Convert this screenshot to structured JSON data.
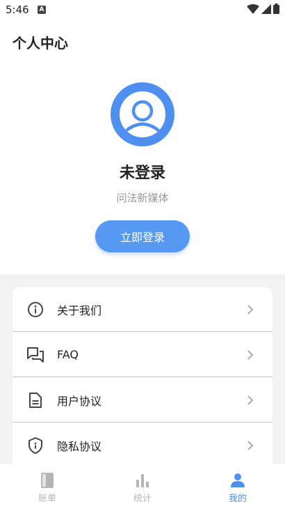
{
  "status_bar": {
    "time": "5:46",
    "notification_icon": "a-icon",
    "wifi_icon": "wifi-icon",
    "signal_icon": "signal-icon",
    "battery_icon": "battery-icon"
  },
  "header": {
    "title": "个人中心"
  },
  "profile": {
    "avatar_icon": "person-icon",
    "name": "未登录",
    "subtitle": "问法新媒体",
    "login_label": "立即登录"
  },
  "menu": {
    "items": [
      {
        "label": "关于我们",
        "icon": "info-icon"
      },
      {
        "label": "FAQ",
        "icon": "chat-icon"
      },
      {
        "label": "用户协议",
        "icon": "document-icon"
      },
      {
        "label": "隐私协议",
        "icon": "shield-icon"
      }
    ]
  },
  "bottom_nav": {
    "items": [
      {
        "label": "账单",
        "icon": "book-icon",
        "active": false
      },
      {
        "label": "统计",
        "icon": "bar-chart-icon",
        "active": false
      },
      {
        "label": "我的",
        "icon": "person-icon",
        "active": true
      }
    ]
  },
  "colors": {
    "accent": "#4f8ff0",
    "inactive": "#b5b5b5",
    "background_grey": "#f2f2f2"
  }
}
